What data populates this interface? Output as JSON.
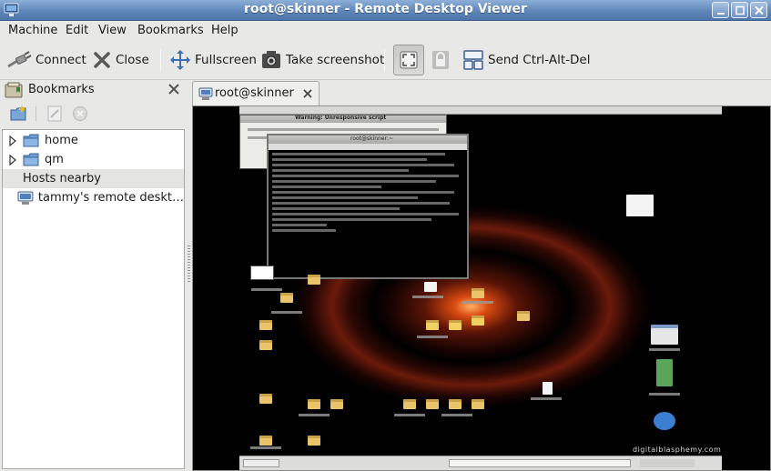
{
  "window": {
    "title": "root@skinner - Remote Desktop Viewer",
    "title_bar_color": "#5f86b8"
  },
  "menubar": {
    "items": [
      "Machine",
      "Edit",
      "View",
      "Bookmarks",
      "Help"
    ]
  },
  "toolbar": {
    "connect_label": "Connect",
    "close_label": "Close",
    "fullscreen_label": "Fullscreen",
    "screenshot_label": "Take screenshot",
    "send_keys_label": "Send Ctrl-Alt-Del",
    "scaling_toggle_active": true
  },
  "sidebar": {
    "title": "Bookmarks",
    "tree": [
      {
        "label": "home",
        "kind": "folder-collapsed"
      },
      {
        "label": "qm",
        "kind": "folder-collapsed"
      },
      {
        "label": "Hosts nearby",
        "kind": "section"
      },
      {
        "label": "tammy's remote deskt…",
        "kind": "host"
      }
    ]
  },
  "tabs": [
    {
      "label": "root@skinner",
      "icon": "computer-icon",
      "active": true
    }
  ],
  "remote_screen": {
    "window_title": "Warning: Unresponsive script",
    "terminal_title": "root@skinner:~",
    "watermark": "digitalblasphemy.com"
  }
}
